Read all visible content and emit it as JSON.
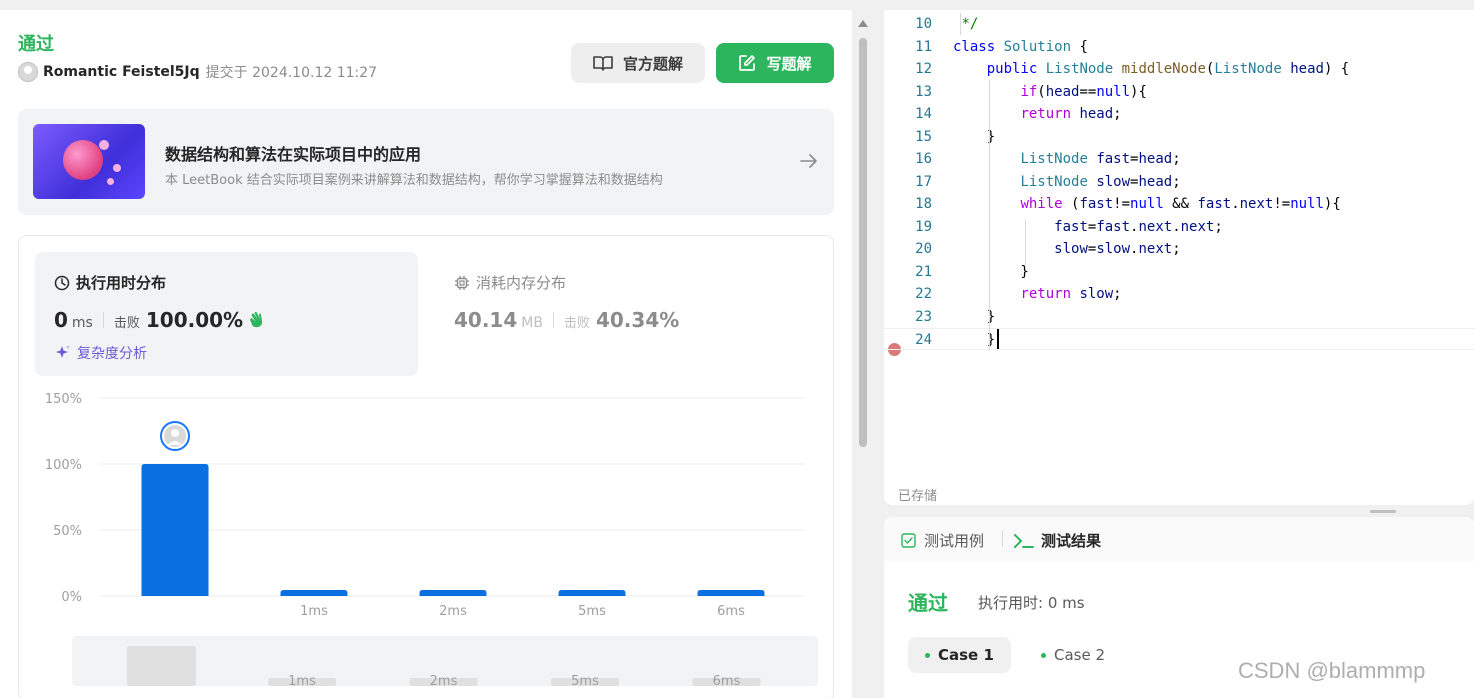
{
  "submission": {
    "status": "通过",
    "user": "Romantic Feistel5Jq",
    "submitted_at": "提交于 2024.10.12 11:27",
    "official_solution_label": "官方题解",
    "write_solution_label": "写题解"
  },
  "banner": {
    "title": "数据结构和算法在实际项目中的应用",
    "description": "本 LeetBook 结合实际项目案例来讲解算法和数据结构，帮你学习掌握算法和数据结构"
  },
  "runtime": {
    "title": "执行用时分布",
    "value": "0",
    "unit": "ms",
    "beat_label": "击败",
    "beat_value": "100.00%",
    "complexity_label": "复杂度分析"
  },
  "memory": {
    "title": "消耗内存分布",
    "value": "40.14",
    "unit": "MB",
    "beat_label": "击败",
    "beat_value": "40.34%"
  },
  "chart_data": {
    "type": "bar",
    "categories": [
      "",
      "1ms",
      "2ms",
      "5ms",
      "6ms"
    ],
    "values": [
      100,
      2,
      2,
      2,
      2
    ],
    "ylim": [
      0,
      150
    ],
    "yticks": [
      "0%",
      "50%",
      "100%",
      "150%"
    ],
    "highlight_index": 0,
    "grid": true,
    "bar_color": "#0a6fe0"
  },
  "minimap": {
    "labels": [
      "1ms",
      "2ms",
      "5ms",
      "6ms"
    ]
  },
  "editor": {
    "lines": [
      {
        "n": "10",
        "html": " <span class=\"cm\">*/</span>"
      },
      {
        "n": "11",
        "html": "<span class=\"kw\">class</span> <span class=\"ty\">Solution</span> {"
      },
      {
        "n": "12",
        "html": "    <span class=\"kw\">public</span> <span class=\"ty\">ListNode</span> <span class=\"fn\">middleNode</span>(<span class=\"ty\">ListNode</span> <span class=\"va\">head</span>) {"
      },
      {
        "n": "13",
        "html": "        <span class=\"kw2\">if</span>(<span class=\"va\">head</span>==<span class=\"kw\">null</span>){"
      },
      {
        "n": "14",
        "html": "        <span class=\"kw2\">return</span> <span class=\"va\">head</span>;"
      },
      {
        "n": "15",
        "html": "    }"
      },
      {
        "n": "16",
        "html": "        <span class=\"ty\">ListNode</span> <span class=\"va\">fast</span>=<span class=\"va\">head</span>;"
      },
      {
        "n": "17",
        "html": "        <span class=\"ty\">ListNode</span> <span class=\"va\">slow</span>=<span class=\"va\">head</span>;"
      },
      {
        "n": "18",
        "html": "        <span class=\"kw2\">while</span> (<span class=\"va\">fast</span>!=<span class=\"kw\">null</span> &amp;&amp; <span class=\"va\">fast</span>.<span class=\"va\">next</span>!=<span class=\"kw\">null</span>){"
      },
      {
        "n": "19",
        "html": "            <span class=\"va\">fast</span>=<span class=\"va\">fast</span>.<span class=\"va\">next</span>.<span class=\"va\">next</span>;"
      },
      {
        "n": "20",
        "html": "            <span class=\"va\">slow</span>=<span class=\"va\">slow</span>.<span class=\"va\">next</span>;"
      },
      {
        "n": "21",
        "html": "        }"
      },
      {
        "n": "22",
        "html": "        <span class=\"kw2\">return</span> <span class=\"va\">slow</span>;"
      },
      {
        "n": "23",
        "html": "    }"
      },
      {
        "n": "24",
        "html": "    }"
      }
    ],
    "saved_label": "已存储"
  },
  "tests": {
    "tab_cases": "测试用例",
    "tab_result": "测试结果",
    "status": "通过",
    "runtime_text": "执行用时: 0 ms",
    "cases": [
      "Case 1",
      "Case 2"
    ]
  },
  "watermark": "CSDN @blammmp",
  "colors": {
    "accent_green": "#2db55d",
    "bar_blue": "#0a6fe0"
  }
}
